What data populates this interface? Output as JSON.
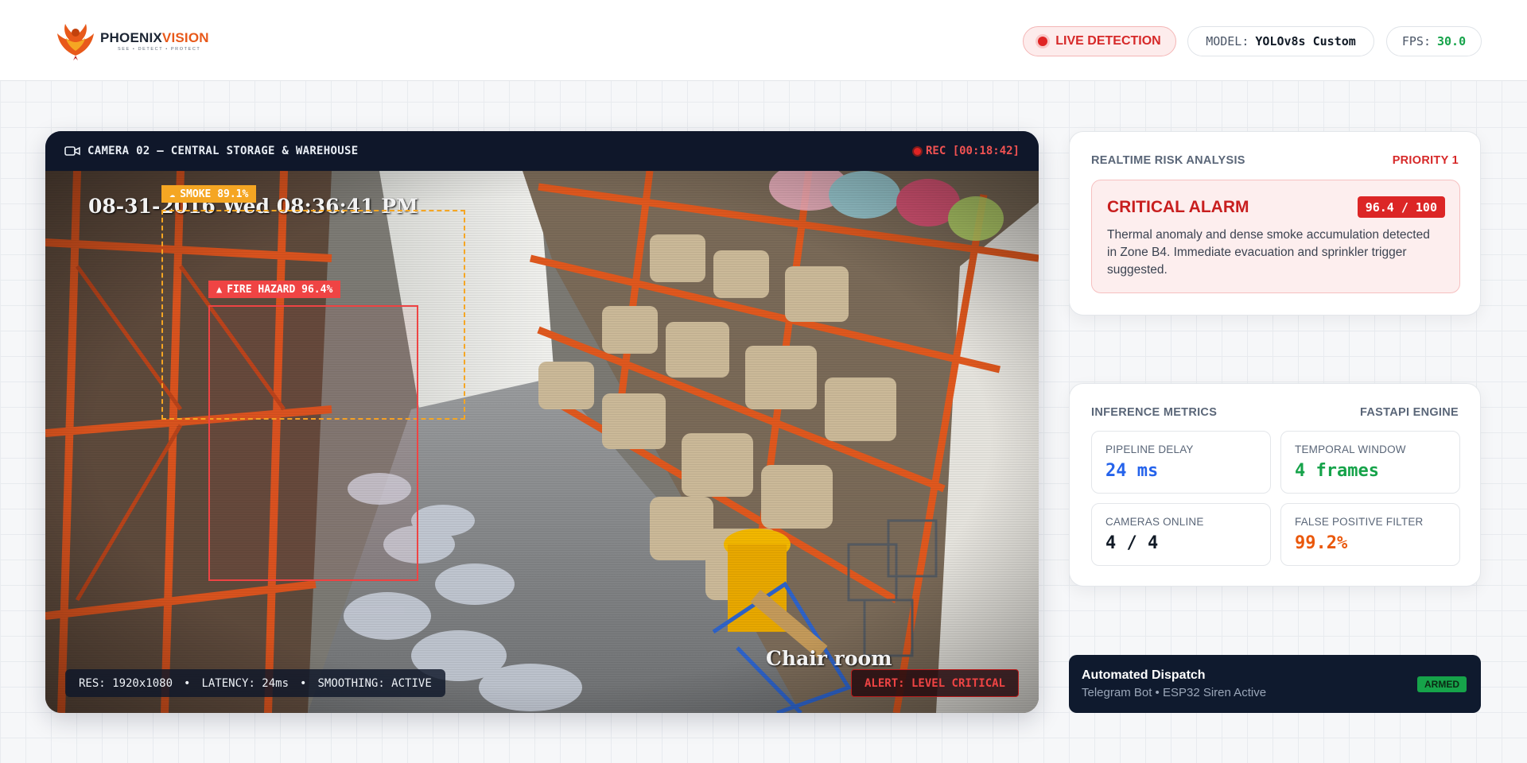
{
  "brand": {
    "name_main": "PHOENIX",
    "name_accent": "VISION",
    "tagline": "SEE • DETECT • PROTECT"
  },
  "header": {
    "live_label": "LIVE DETECTION",
    "model_key": "MODEL:",
    "model_value": "YOLOv8s Custom",
    "fps_key": "FPS:",
    "fps_value": "30.0"
  },
  "camera": {
    "title": "CAMERA 02 — CENTRAL STORAGE & WAREHOUSE",
    "rec": "REC [00:18:42]",
    "osd_timestamp": "08-31-2016 Wed 08:36:41 PM",
    "osd_room": "Chair room",
    "detections": [
      {
        "label": "SMOKE 89.1%",
        "icon": "smoke-icon",
        "color": "#f5a623"
      },
      {
        "label": "FIRE HAZARD 96.4%",
        "icon": "fire-icon",
        "color": "#ef4444"
      }
    ],
    "hud": {
      "res": "RES: 1920x1080",
      "latency": "LATENCY: 24ms",
      "smoothing": "SMOOTHING: ACTIVE",
      "separator": "•"
    },
    "alert": "ALERT: LEVEL CRITICAL"
  },
  "risk": {
    "heading": "REALTIME RISK ANALYSIS",
    "priority": "PRIORITY 1",
    "alarm_title": "CRITICAL ALARM",
    "score": "96.4 / 100",
    "description": "Thermal anomaly and dense smoke accumulation detected in Zone B4. Immediate evacuation and sprinkler trigger suggested."
  },
  "metrics": {
    "heading": "INFERENCE METRICS",
    "engine": "FASTAPI ENGINE",
    "items": [
      {
        "label": "PIPELINE DELAY",
        "value": "24 ms",
        "color": "#2563eb"
      },
      {
        "label": "TEMPORAL WINDOW",
        "value": "4 frames",
        "color": "#16a34a"
      },
      {
        "label": "CAMERAS ONLINE",
        "value": "4 / 4",
        "color": "#111a26"
      },
      {
        "label": "FALSE POSITIVE FILTER",
        "value": "99.2%",
        "color": "#ea580c"
      }
    ]
  },
  "dispatch": {
    "title": "Automated Dispatch",
    "subtitle": "Telegram Bot • ESP32 Siren Active",
    "status": "ARMED"
  },
  "colors": {
    "accent": "#e8591a",
    "critical": "#dc2626",
    "ok": "#16a34a",
    "navy": "#0f172a"
  }
}
